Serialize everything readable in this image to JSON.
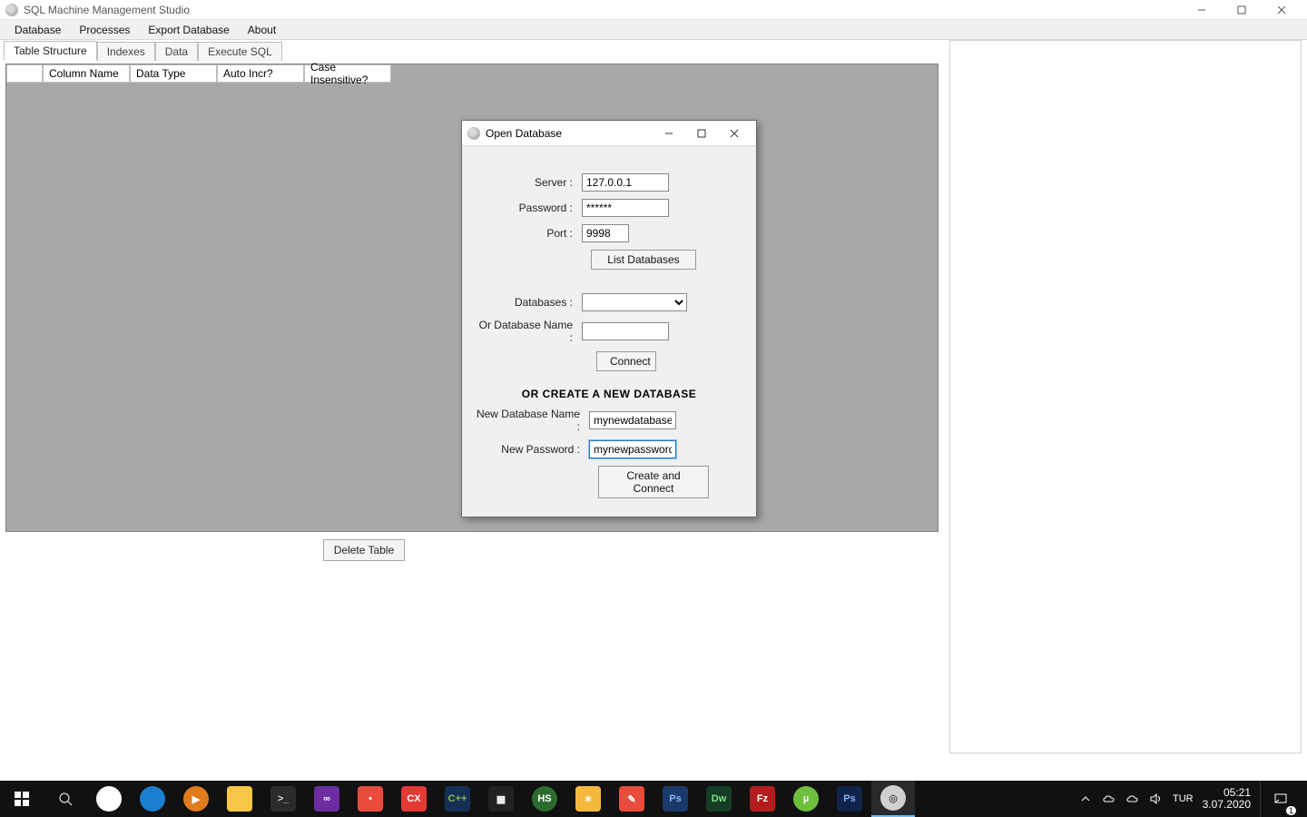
{
  "window": {
    "title": "SQL Machine Management Studio"
  },
  "menubar": {
    "items": [
      "Database",
      "Processes",
      "Export Database",
      "About"
    ]
  },
  "tabs": {
    "items": [
      "Table Structure",
      "Indexes",
      "Data",
      "Execute SQL"
    ],
    "active_index": 0
  },
  "grid": {
    "headers": [
      "",
      "Column Name",
      "Data Type",
      "Auto Incr?",
      "Case Insensitive?"
    ]
  },
  "buttons": {
    "delete_table": "Delete Table"
  },
  "dialog": {
    "title": "Open Database",
    "labels": {
      "server": "Server :",
      "password": "Password :",
      "port": "Port :",
      "databases": "Databases :",
      "or_db_name": "Or Database Name :",
      "new_db_name": "New Database Name :",
      "new_password": "New Password :"
    },
    "values": {
      "server": "127.0.0.1",
      "password": "******",
      "port": "9998",
      "databases_selected": "",
      "or_db_name": "",
      "new_db_name": "mynewdatabase",
      "new_password": "mynewpassword"
    },
    "buttons": {
      "list_databases": "List Databases",
      "connect": "Connect",
      "create_connect": "Create and Connect"
    },
    "section_title": "OR CREATE A NEW DATABASE"
  },
  "taskbar": {
    "apps": [
      {
        "name": "chrome-icon",
        "bg": "#fff",
        "fg": "#db4437",
        "label": ""
      },
      {
        "name": "edge-icon",
        "bg": "#1b7fcf",
        "fg": "#fff",
        "label": ""
      },
      {
        "name": "media-player-icon",
        "bg": "#e07b1e",
        "fg": "#fff",
        "label": "▶"
      },
      {
        "name": "explorer-icon",
        "bg": "#f7c646",
        "fg": "#3b5d9a",
        "label": ""
      },
      {
        "name": "cmd-icon",
        "bg": "#2b2b2b",
        "fg": "#ddd",
        "label": ">_"
      },
      {
        "name": "visual-studio-icon",
        "bg": "#6b2da0",
        "fg": "#fff",
        "label": "∞"
      },
      {
        "name": "app-red1-icon",
        "bg": "#e94b3c",
        "fg": "#fff",
        "label": "•"
      },
      {
        "name": "app-cx-icon",
        "bg": "#e53935",
        "fg": "#fff",
        "label": "CX"
      },
      {
        "name": "app-cpp-icon",
        "bg": "#152f56",
        "fg": "#8abf4a",
        "label": "C++"
      },
      {
        "name": "app-tiles-icon",
        "bg": "#222",
        "fg": "#fff",
        "label": "▦"
      },
      {
        "name": "app-hs-icon",
        "bg": "#2e6b2f",
        "fg": "#fff",
        "label": "HS"
      },
      {
        "name": "app-yellow1-icon",
        "bg": "#f6b83c",
        "fg": "#fff",
        "label": "✶"
      },
      {
        "name": "app-red-note-icon",
        "bg": "#e94b3c",
        "fg": "#fff",
        "label": "✎"
      },
      {
        "name": "photoshop-icon",
        "bg": "#1a3a6a",
        "fg": "#7fb6ff",
        "label": "Ps"
      },
      {
        "name": "dreamweaver-icon",
        "bg": "#143d26",
        "fg": "#7fe07f",
        "label": "Dw"
      },
      {
        "name": "filezilla-icon",
        "bg": "#b31d1d",
        "fg": "#fff",
        "label": "Fz"
      },
      {
        "name": "utorrent-icon",
        "bg": "#6fbf3f",
        "fg": "#fff",
        "label": "µ"
      },
      {
        "name": "photoshop2-icon",
        "bg": "#10234a",
        "fg": "#7fb6ff",
        "label": "Ps"
      },
      {
        "name": "sqlmachine-icon",
        "bg": "#d0d0d0",
        "fg": "#555",
        "label": "◎",
        "active": true
      }
    ],
    "tray": {
      "lang": "TUR",
      "time": "05:21",
      "date": "3.07.2020",
      "badge": "1"
    }
  }
}
